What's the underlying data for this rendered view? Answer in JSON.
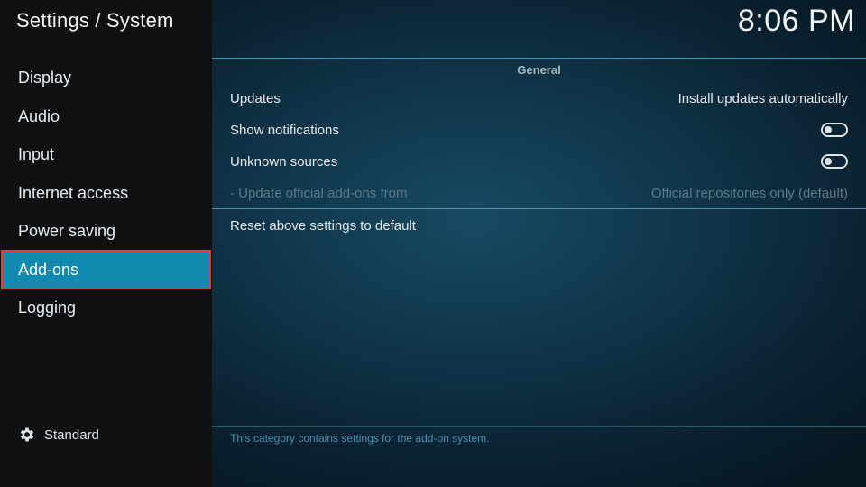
{
  "header": {
    "title": "Settings / System",
    "clock": "8:06 PM"
  },
  "sidebar": {
    "items": [
      {
        "label": "Display"
      },
      {
        "label": "Audio"
      },
      {
        "label": "Input"
      },
      {
        "label": "Internet access"
      },
      {
        "label": "Power saving"
      },
      {
        "label": "Add-ons",
        "selected": true
      },
      {
        "label": "Logging"
      }
    ],
    "level": {
      "label": "Standard",
      "icon": "gear-icon"
    }
  },
  "main": {
    "section_title": "General",
    "settings": [
      {
        "label": "Updates",
        "value": "Install updates automatically"
      },
      {
        "label": "Show notifications",
        "toggle": "off"
      },
      {
        "label": "Unknown sources",
        "toggle": "off"
      },
      {
        "label": "- Update official add-ons from",
        "value": "Official repositories only (default)",
        "disabled": true
      }
    ],
    "reset_label": "Reset above settings to default",
    "help_text": "This category contains settings for the add-on system."
  },
  "colors": {
    "selected_item": "#128ab0",
    "highlight_outline": "#e53b3b",
    "panel_bg": "#174a63"
  }
}
